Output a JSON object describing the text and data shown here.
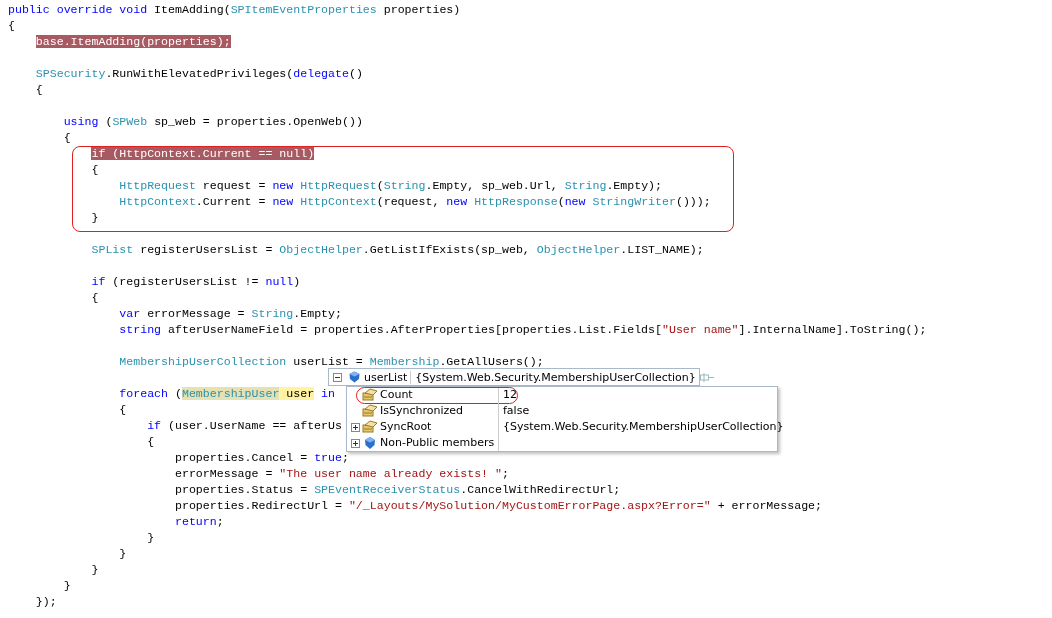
{
  "lines": [
    {
      "kind": "code",
      "tokens": [
        {
          "t": "public override void",
          "kind": "keyword"
        },
        {
          "t": " ItemAdding(",
          "kind": "plain"
        },
        {
          "t": "SPItemEventProperties",
          "kind": "type"
        },
        {
          "t": " properties)",
          "kind": "plain"
        }
      ]
    },
    {
      "kind": "code",
      "tokens": [
        {
          "t": "{",
          "kind": "plain"
        }
      ]
    },
    {
      "kind": "block",
      "children": [
        {
          "kind": "code",
          "tokens": [
            {
              "t": "base.ItemAdding(properties);",
              "kind": "breakpoint"
            }
          ]
        },
        {
          "kind": "blank"
        },
        {
          "kind": "code",
          "tokens": [
            {
              "t": "SPSecurity",
              "kind": "type"
            },
            {
              "t": ".RunWithElevatedPrivileges(",
              "kind": "plain"
            },
            {
              "t": "delegate",
              "kind": "keyword"
            },
            {
              "t": "()",
              "kind": "plain"
            }
          ]
        },
        {
          "kind": "code",
          "tokens": [
            {
              "t": "{",
              "kind": "plain"
            }
          ]
        },
        {
          "kind": "block",
          "children": [
            {
              "kind": "blank"
            },
            {
              "kind": "code",
              "tokens": [
                {
                  "t": "using",
                  "kind": "keyword"
                },
                {
                  "t": " (",
                  "kind": "plain"
                },
                {
                  "t": "SPWeb",
                  "kind": "type"
                },
                {
                  "t": " sp_web = properties.OpenWeb())",
                  "kind": "plain"
                }
              ]
            },
            {
              "kind": "code",
              "tokens": [
                {
                  "t": "{",
                  "kind": "plain"
                }
              ]
            },
            {
              "kind": "block",
              "children": [
                {
                  "kind": "outlined",
                  "children": [
                    {
                      "kind": "code",
                      "tokens": [
                        {
                          "t": "if (HttpContext.Current == null)",
                          "kind": "breakpoint"
                        }
                      ]
                    },
                    {
                      "kind": "code",
                      "tokens": [
                        {
                          "t": "{",
                          "kind": "plain"
                        }
                      ]
                    },
                    {
                      "kind": "block",
                      "children": [
                        {
                          "kind": "code",
                          "tokens": [
                            {
                              "t": "HttpRequest",
                              "kind": "type"
                            },
                            {
                              "t": " request = ",
                              "kind": "plain"
                            },
                            {
                              "t": "new",
                              "kind": "keyword"
                            },
                            {
                              "t": " HttpRequest",
                              "kind": "type"
                            },
                            {
                              "t": "(",
                              "kind": "plain"
                            },
                            {
                              "t": "String",
                              "kind": "type"
                            },
                            {
                              "t": ".Empty, sp_web.Url, ",
                              "kind": "plain"
                            },
                            {
                              "t": "String",
                              "kind": "type"
                            },
                            {
                              "t": ".Empty);",
                              "kind": "plain"
                            }
                          ]
                        },
                        {
                          "kind": "code",
                          "tokens": [
                            {
                              "t": "HttpContext",
                              "kind": "type"
                            },
                            {
                              "t": ".Current = ",
                              "kind": "plain"
                            },
                            {
                              "t": "new",
                              "kind": "keyword"
                            },
                            {
                              "t": " HttpContext",
                              "kind": "type"
                            },
                            {
                              "t": "(request, ",
                              "kind": "plain"
                            },
                            {
                              "t": "new",
                              "kind": "keyword"
                            },
                            {
                              "t": " HttpResponse",
                              "kind": "type"
                            },
                            {
                              "t": "(",
                              "kind": "plain"
                            },
                            {
                              "t": "new",
                              "kind": "keyword"
                            },
                            {
                              "t": " StringWriter",
                              "kind": "type"
                            },
                            {
                              "t": "()));",
                              "kind": "plain"
                            }
                          ]
                        }
                      ]
                    },
                    {
                      "kind": "code",
                      "tokens": [
                        {
                          "t": "}",
                          "kind": "plain"
                        }
                      ]
                    }
                  ]
                },
                {
                  "kind": "blank"
                },
                {
                  "kind": "code",
                  "tokens": [
                    {
                      "t": "SPList",
                      "kind": "type"
                    },
                    {
                      "t": " registerUsersList = ",
                      "kind": "plain"
                    },
                    {
                      "t": "ObjectHelper",
                      "kind": "type"
                    },
                    {
                      "t": ".GetListIfExists(sp_web, ",
                      "kind": "plain"
                    },
                    {
                      "t": "ObjectHelper",
                      "kind": "type"
                    },
                    {
                      "t": ".LIST_NAME);",
                      "kind": "plain"
                    }
                  ]
                },
                {
                  "kind": "blank"
                },
                {
                  "kind": "code",
                  "tokens": [
                    {
                      "t": "if",
                      "kind": "keyword"
                    },
                    {
                      "t": " (registerUsersList != ",
                      "kind": "plain"
                    },
                    {
                      "t": "null",
                      "kind": "keyword"
                    },
                    {
                      "t": ")",
                      "kind": "plain"
                    }
                  ]
                },
                {
                  "kind": "code",
                  "tokens": [
                    {
                      "t": "{",
                      "kind": "plain"
                    }
                  ]
                },
                {
                  "kind": "block",
                  "children": [
                    {
                      "kind": "code",
                      "tokens": [
                        {
                          "t": "var",
                          "kind": "keyword"
                        },
                        {
                          "t": " errorMessage = ",
                          "kind": "plain"
                        },
                        {
                          "t": "String",
                          "kind": "type"
                        },
                        {
                          "t": ".Empty;",
                          "kind": "plain"
                        }
                      ]
                    },
                    {
                      "kind": "code",
                      "tokens": [
                        {
                          "t": "string",
                          "kind": "keyword"
                        },
                        {
                          "t": " afterUserNameField = properties.AfterProperties[properties.List.Fields[",
                          "kind": "plain"
                        },
                        {
                          "t": "\"User name\"",
                          "kind": "string"
                        },
                        {
                          "t": "].InternalName].ToString();",
                          "kind": "plain"
                        }
                      ]
                    },
                    {
                      "kind": "blank"
                    },
                    {
                      "kind": "code",
                      "tokens": [
                        {
                          "t": "MembershipUserCollection",
                          "kind": "type"
                        },
                        {
                          "t": " userList = ",
                          "kind": "plain"
                        },
                        {
                          "t": "Membership",
                          "kind": "type"
                        },
                        {
                          "t": ".GetAllUsers();",
                          "kind": "plain"
                        }
                      ]
                    },
                    {
                      "kind": "blank"
                    },
                    {
                      "kind": "code",
                      "tokens": [
                        {
                          "t": "foreach",
                          "kind": "keyword"
                        },
                        {
                          "t": " (",
                          "kind": "plain"
                        },
                        {
                          "t": "MembershipUser",
                          "kind": "reference"
                        },
                        {
                          "t": " user",
                          "kind": "current"
                        },
                        {
                          "t": " in",
                          "kind": "keyword"
                        }
                      ]
                    },
                    {
                      "kind": "code",
                      "tokens": [
                        {
                          "t": "{",
                          "kind": "plain"
                        }
                      ]
                    },
                    {
                      "kind": "block",
                      "children": [
                        {
                          "kind": "code",
                          "tokens": [
                            {
                              "t": "if",
                              "kind": "keyword"
                            },
                            {
                              "t": " (user.UserName == afterUs",
                              "kind": "plain"
                            }
                          ]
                        },
                        {
                          "kind": "code",
                          "tokens": [
                            {
                              "t": "{",
                              "kind": "plain"
                            }
                          ]
                        },
                        {
                          "kind": "block",
                          "children": [
                            {
                              "kind": "code",
                              "tokens": [
                                {
                                  "t": "properties.Cancel = ",
                                  "kind": "plain"
                                },
                                {
                                  "t": "true",
                                  "kind": "keyword"
                                },
                                {
                                  "t": ";",
                                  "kind": "plain"
                                }
                              ]
                            },
                            {
                              "kind": "code",
                              "tokens": [
                                {
                                  "t": "errorMessage = ",
                                  "kind": "plain"
                                },
                                {
                                  "t": "\"The user name already exists! \"",
                                  "kind": "string"
                                },
                                {
                                  "t": ";",
                                  "kind": "plain"
                                }
                              ]
                            },
                            {
                              "kind": "code",
                              "tokens": [
                                {
                                  "t": "properties.Status = ",
                                  "kind": "plain"
                                },
                                {
                                  "t": "SPEventReceiverStatus",
                                  "kind": "type"
                                },
                                {
                                  "t": ".CancelWithRedirectUrl;",
                                  "kind": "plain"
                                }
                              ]
                            },
                            {
                              "kind": "code",
                              "tokens": [
                                {
                                  "t": "properties.RedirectUrl = ",
                                  "kind": "plain"
                                },
                                {
                                  "t": "\"/_Layouts/MySolution/MyCustomErrorPage.aspx?Error=\"",
                                  "kind": "string"
                                },
                                {
                                  "t": " + errorMessage;",
                                  "kind": "plain"
                                }
                              ]
                            },
                            {
                              "kind": "code",
                              "tokens": [
                                {
                                  "t": "return",
                                  "kind": "keyword"
                                },
                                {
                                  "t": ";",
                                  "kind": "plain"
                                }
                              ]
                            }
                          ]
                        },
                        {
                          "kind": "code",
                          "tokens": [
                            {
                              "t": "}",
                              "kind": "plain"
                            }
                          ]
                        }
                      ]
                    },
                    {
                      "kind": "code",
                      "tokens": [
                        {
                          "t": "}",
                          "kind": "plain"
                        }
                      ]
                    }
                  ]
                },
                {
                  "kind": "code",
                  "tokens": [
                    {
                      "t": "}",
                      "kind": "plain"
                    }
                  ]
                }
              ]
            },
            {
              "kind": "code",
              "tokens": [
                {
                  "t": "}",
                  "kind": "plain"
                }
              ]
            }
          ]
        },
        {
          "kind": "code",
          "tokens": [
            {
              "t": "});",
              "kind": "plain"
            }
          ]
        }
      ]
    }
  ],
  "datatip": {
    "expanded": true,
    "name": "userList",
    "value": "{System.Web.Security.MembershipUserCollection}",
    "rows": [
      {
        "kind": "property",
        "name": "Count",
        "value": "12",
        "expandable": false,
        "outlined": true
      },
      {
        "kind": "property",
        "name": "IsSynchronized",
        "value": "false",
        "expandable": false,
        "outlined": false
      },
      {
        "kind": "property",
        "name": "SyncRoot",
        "value": "{System.Web.Security.MembershipUserCollection}",
        "expandable": true,
        "outlined": false
      },
      {
        "kind": "members",
        "name": "Non-Public members",
        "expandable": true,
        "outlined": false
      }
    ]
  }
}
